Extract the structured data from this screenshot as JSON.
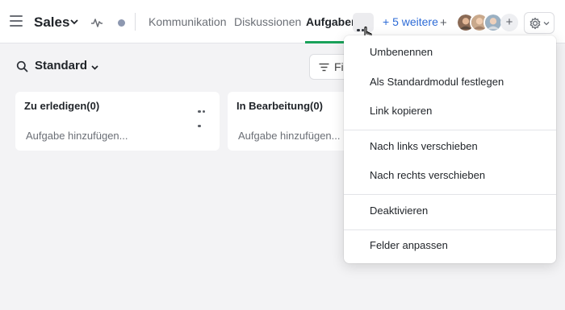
{
  "header": {
    "app_title": "Sales",
    "tabs": [
      {
        "label": "Kommunikation",
        "active": false
      },
      {
        "label": "Diskussionen",
        "active": false
      },
      {
        "label": "Aufgaben",
        "active": true
      }
    ],
    "more_tabs_link": "+ 5 weitere",
    "add_symbol": "+",
    "avatar_add_symbol": "+"
  },
  "toolbar": {
    "view_label": "Standard",
    "filter_label": "Fil"
  },
  "columns": [
    {
      "title": "Zu erledigen(0)",
      "add_placeholder": "Aufgabe hinzufügen..."
    },
    {
      "title": "In Bearbeitung(0)",
      "add_placeholder": "Aufgabe hinzufügen..."
    }
  ],
  "menu": {
    "items": [
      "Umbenennen",
      "Als Standardmodul festlegen",
      "Link kopieren",
      "Nach links verschieben",
      "Nach rechts verschieben",
      "Deaktivieren",
      "Felder anpassen"
    ]
  },
  "colors": {
    "accent_green": "#1aa25a",
    "link_blue": "#2d6bd6",
    "background": "#f3f3f5"
  }
}
